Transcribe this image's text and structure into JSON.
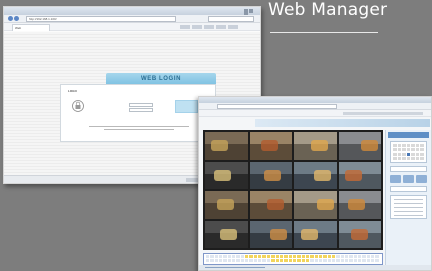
{
  "heading": {
    "text": "Web Manager"
  },
  "login_window": {
    "url": "http://192.168.1.100/",
    "tab_label": "Web",
    "banner": "WEB LOGIN",
    "logo_text": "LOGO"
  },
  "monitor_window": {
    "camera_count": 16,
    "timeline_rows": 2
  },
  "colors": {
    "background": "#7d7d7d",
    "login_banner": "#8ecbe6",
    "grid_background": "#1d1d1d",
    "timeline_highlight": "#f2d55c",
    "side_panel_accent": "#5e8fc6"
  }
}
